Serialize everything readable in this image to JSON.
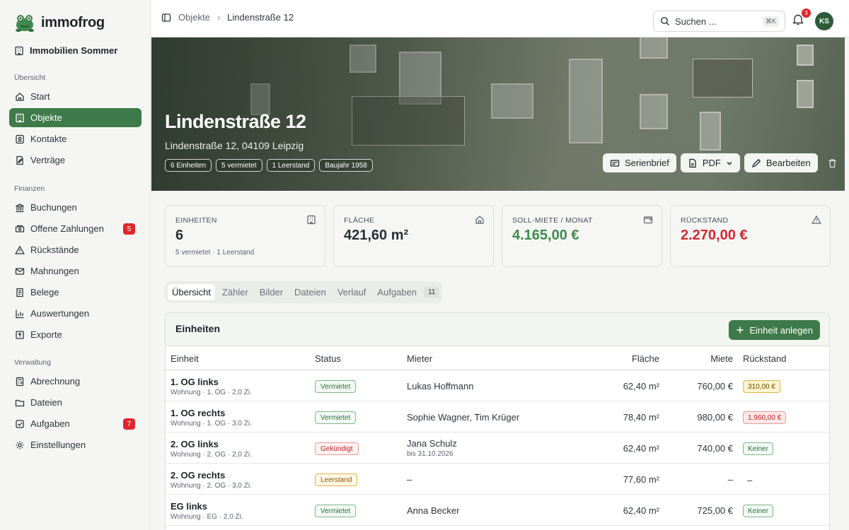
{
  "app": {
    "name": "immofrog"
  },
  "sidebar": {
    "org": "Immobilien Sommer",
    "sections": {
      "overview": "Übersicht",
      "finance": "Finanzen",
      "admin": "Verwaltung"
    },
    "items": [
      {
        "label": "Start"
      },
      {
        "label": "Objekte"
      },
      {
        "label": "Kontakte"
      },
      {
        "label": "Verträge"
      },
      {
        "label": "Buchungen"
      },
      {
        "label": "Offene Zahlungen",
        "count": "5"
      },
      {
        "label": "Rückstände"
      },
      {
        "label": "Mahnungen"
      },
      {
        "label": "Belege"
      },
      {
        "label": "Auswertungen"
      },
      {
        "label": "Exporte"
      },
      {
        "label": "Abrechnung"
      },
      {
        "label": "Dateien"
      },
      {
        "label": "Aufgaben",
        "count": "7"
      },
      {
        "label": "Einstellungen"
      }
    ]
  },
  "topbar": {
    "breadcrumb": [
      "Objekte",
      "Lindenstraße 12"
    ],
    "search_placeholder": "Suchen ...",
    "search_shortcut": "⌘K",
    "notifications": "3",
    "avatar": "KS"
  },
  "hero": {
    "title": "Lindenstraße 12",
    "address": "Lindenstraße 12, 04109 Leipzig",
    "tags": [
      "6 Einheiten",
      "5 vermietet",
      "1 Leerstand",
      "Baujahr 1958"
    ],
    "buttons": {
      "serienbrief": "Serienbrief",
      "pdf": "PDF",
      "edit": "Bearbeiten"
    }
  },
  "stats": [
    {
      "label": "Einheiten",
      "value": "6",
      "sub": "5 vermietet · 1 Leerstand"
    },
    {
      "label": "Fläche",
      "value": "421,60 m²"
    },
    {
      "label": "Soll-Miete / Monat",
      "value": "4.165,00 €"
    },
    {
      "label": "Rückstand",
      "value": "2.270,00 €"
    }
  ],
  "colors": {
    "accent": "#3f7a4a",
    "positive": "#3f8a4d",
    "negative": "#d7262f"
  },
  "tabs": [
    {
      "label": "Übersicht"
    },
    {
      "label": "Zähler"
    },
    {
      "label": "Bilder"
    },
    {
      "label": "Dateien"
    },
    {
      "label": "Verlauf"
    },
    {
      "label": "Aufgaben",
      "count": "11"
    }
  ],
  "units_panel": {
    "title": "Einheiten",
    "add_button": "Einheit anlegen",
    "columns": [
      "Einheit",
      "Status",
      "Mieter",
      "Fläche",
      "Miete",
      "Rückstand"
    ],
    "rows": [
      {
        "name": "1. OG links",
        "sub": "Wohnung · 1. OG · 2,0 Zi.",
        "status": "Vermietet",
        "tenant": "Lukas Hoffmann",
        "tenant_sub": "",
        "area": "62,40 m²",
        "rent": "760,00 €",
        "arrears": "310,00 €"
      },
      {
        "name": "1. OG rechts",
        "sub": "Wohnung · 1. OG · 3,0 Zi.",
        "status": "Vermietet",
        "tenant": "Sophie Wagner, Tim Krüger",
        "tenant_sub": "",
        "area": "78,40 m²",
        "rent": "980,00 €",
        "arrears": "1.960,00 €"
      },
      {
        "name": "2. OG links",
        "sub": "Wohnung · 2. OG · 2,0 Zi.",
        "status": "Gekündigt",
        "tenant": "Jana Schulz",
        "tenant_sub": "bis 31.10.2026",
        "area": "62,40 m²",
        "rent": "740,00 €",
        "arrears": "Keiner"
      },
      {
        "name": "2. OG rechts",
        "sub": "Wohnung · 2. OG · 3,0 Zi.",
        "status": "Leerstand",
        "tenant": "–",
        "tenant_sub": "",
        "area": "77,60 m²",
        "rent": "–",
        "arrears": "–"
      },
      {
        "name": "EG links",
        "sub": "Wohnung · EG · 2,0 Zi.",
        "status": "Vermietet",
        "tenant": "Anna Becker",
        "tenant_sub": "",
        "area": "62,40 m²",
        "rent": "725,00 €",
        "arrears": "Keiner"
      }
    ]
  }
}
